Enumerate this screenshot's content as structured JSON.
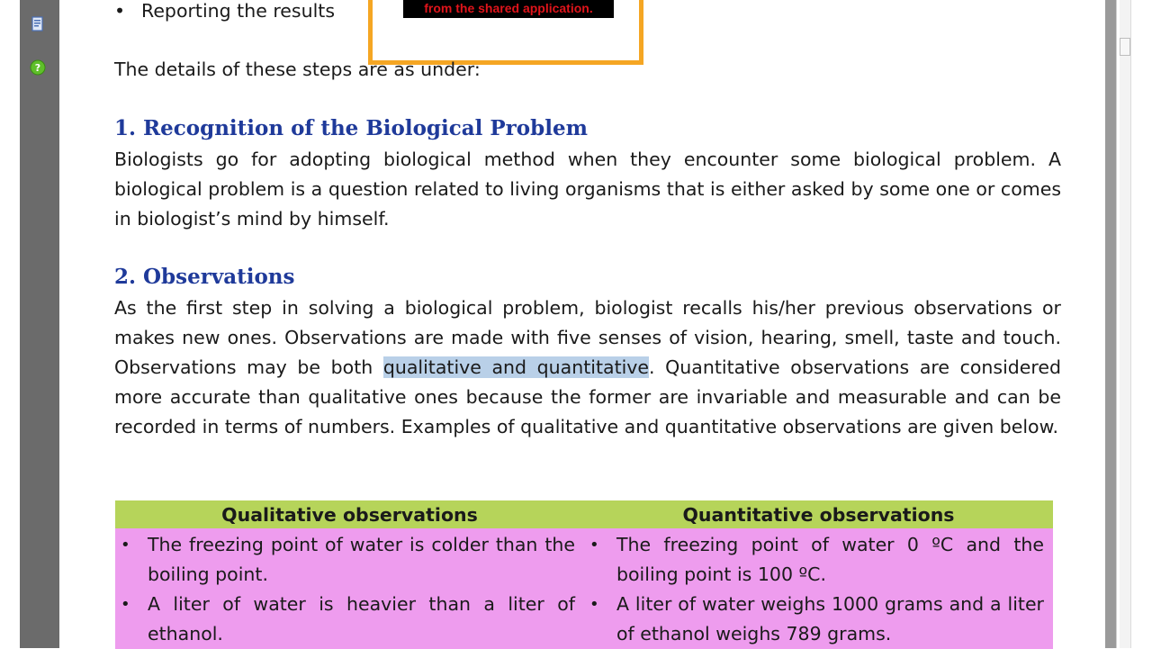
{
  "viewer": {
    "pages_icon": "pages-icon",
    "help_icon": "help-icon"
  },
  "share_notice": {
    "text": "from the shared application."
  },
  "top_bullet": {
    "bullet": "•",
    "text": "Reporting the results"
  },
  "intro": "The details of these steps are as under:",
  "section1": {
    "heading": "1. Recognition of the Biological Problem",
    "paragraph": "Biologists go for adopting biological method when they encounter some biological problem. A biological problem is a question related to living organisms that is either asked by some one or comes in biologist’s mind by himself."
  },
  "section2": {
    "heading": "2. Observations",
    "paragraph_before": "As the first step in solving a biological problem, biologist recalls his/her previous observations or makes new ones. Observations are made with five senses of vision, hearing, smell, taste and touch. Observations may be both ",
    "paragraph_highlight": "qualitative and quantitative",
    "paragraph_after": ". Quantitative observations are considered more accurate than qualitative ones because the former are invariable and measurable and can be recorded in terms of numbers. Examples of qualitative and quantitative observations are given below."
  },
  "table": {
    "headers": [
      "Qualitative observations",
      "Quantitative observations"
    ],
    "qualitative": [
      "The freezing point of water  is colder than the boiling point.",
      "A liter of water is heavier than a liter of ethanol."
    ],
    "quantitative": [
      "The freezing point of water  0 ºC and the boiling point is 100 ºC.",
      "A liter of water weighs 1000 grams and a liter of ethanol weighs 789 grams."
    ]
  },
  "colors": {
    "heading": "#1f3a9a",
    "table_header": "#b6d45a",
    "table_body": "#ee9cee",
    "highlight": "#b9d0e8",
    "notice_border": "#f5a623"
  }
}
